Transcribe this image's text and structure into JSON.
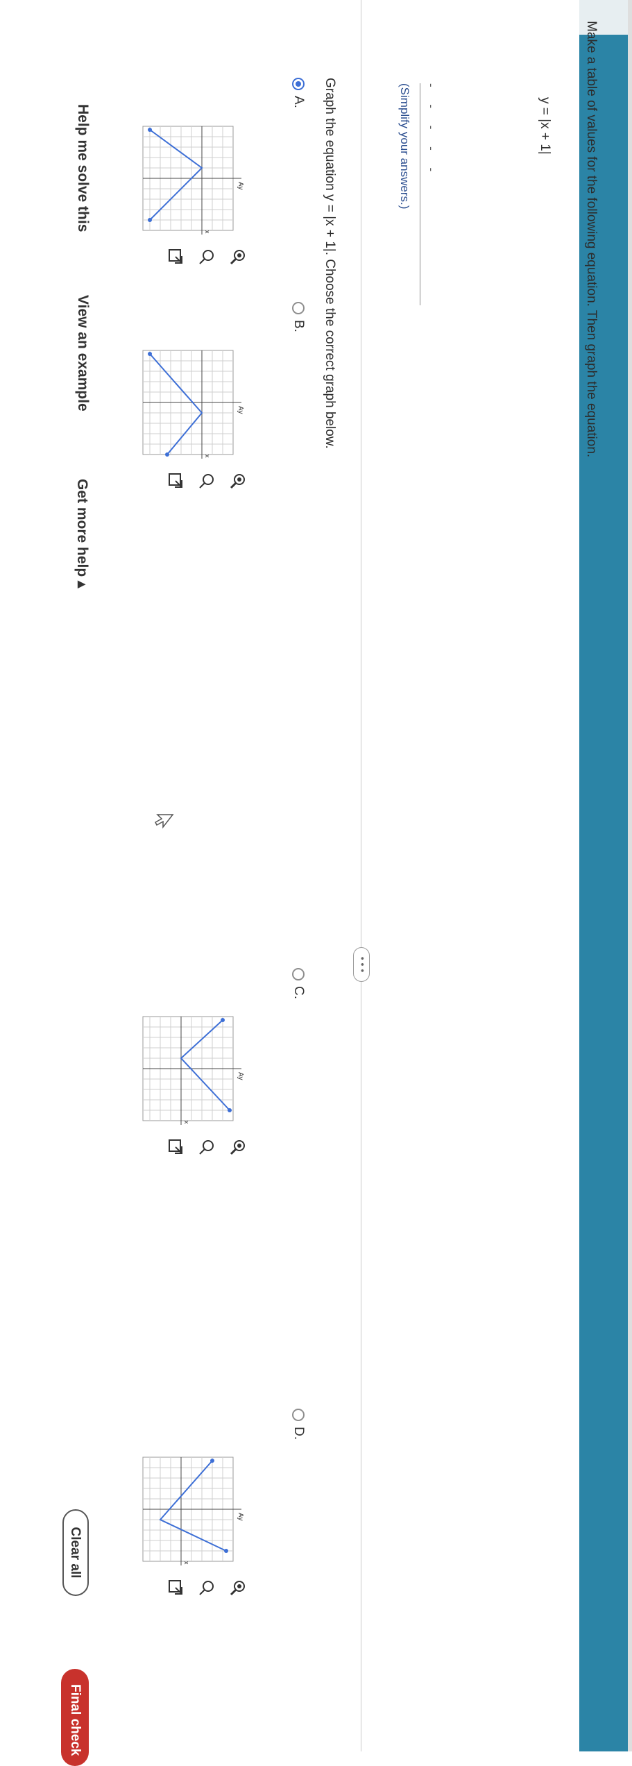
{
  "question": {
    "prompt": "Make a table of values for the following equation. Then graph the equation.",
    "equation": "y = |x + 1|",
    "table_hint": "‐ ‐ ‐ ‐ ‐",
    "simplify_note": "(Simplify your answers.)"
  },
  "more_button": "• • •",
  "graph_question": "Graph the equation y = |x + 1|. Choose the correct graph below.",
  "options": [
    {
      "label": "A.",
      "selected": true
    },
    {
      "label": "B.",
      "selected": false
    },
    {
      "label": "C.",
      "selected": false
    },
    {
      "label": "D.",
      "selected": false
    }
  ],
  "graph_axis": {
    "x": "x",
    "y": "Ay",
    "tick_top": "2",
    "tick_bottom": "-6",
    "tick_left": "-6",
    "tick_right": "6"
  },
  "footer": {
    "help": "Help me solve this",
    "example": "View an example",
    "more_help": "Get more help ▴",
    "clear": "Clear all",
    "final": "Final check"
  },
  "colors": {
    "accent": "#3d6fd6",
    "band": "#2b84a6",
    "final": "#c8322c"
  }
}
